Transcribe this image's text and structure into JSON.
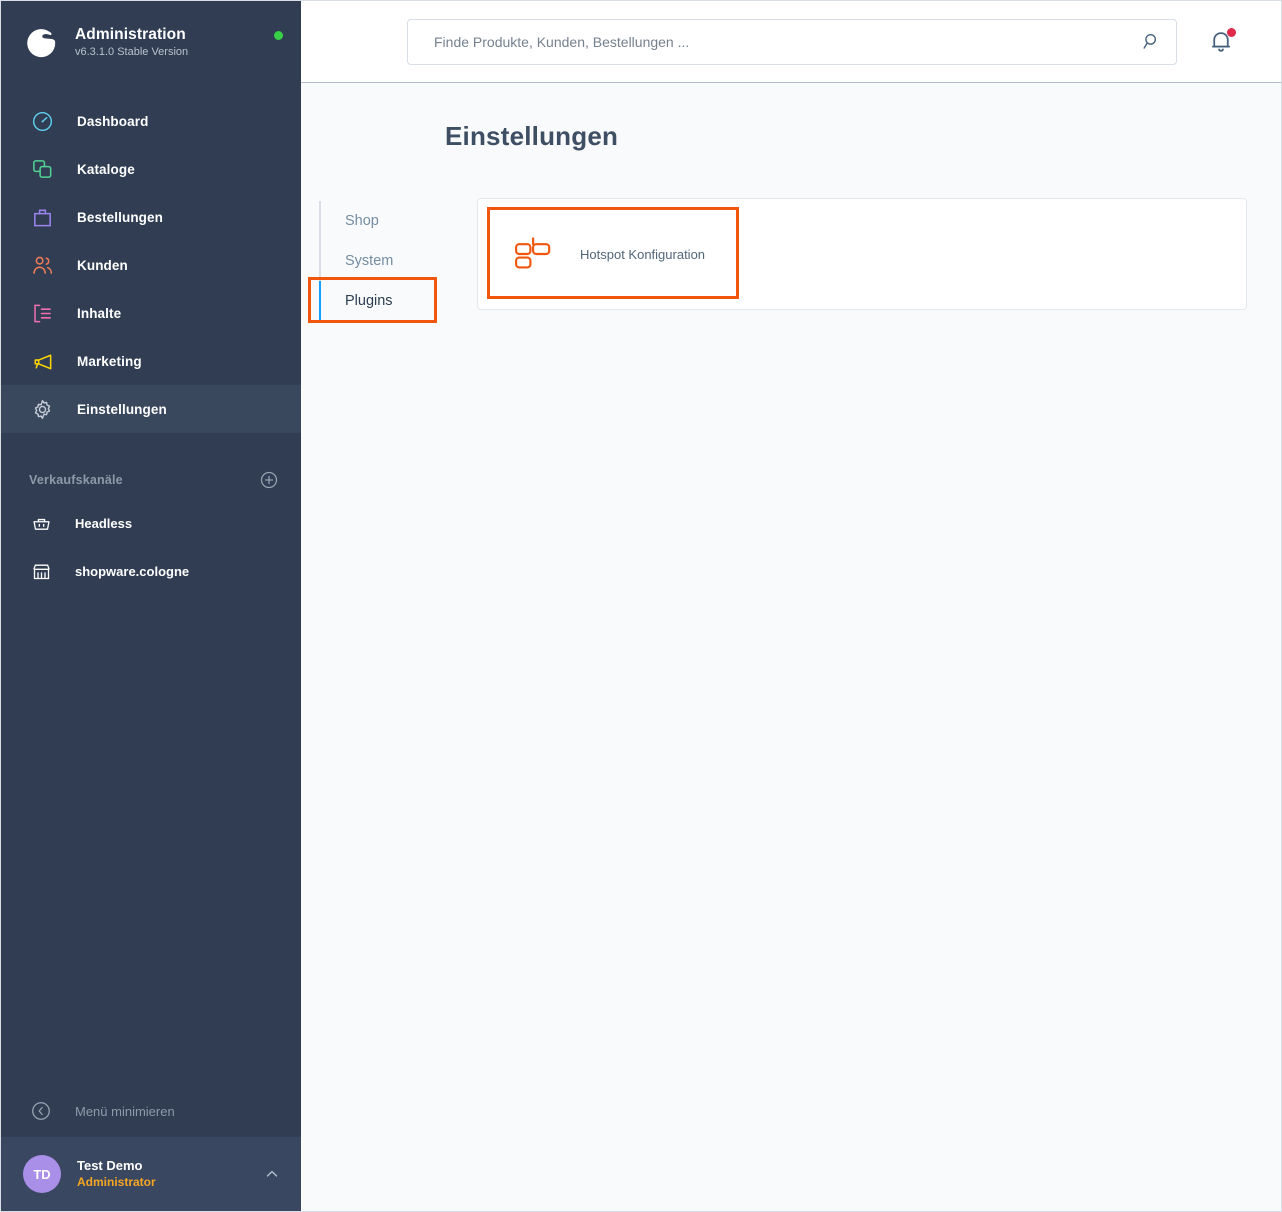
{
  "app": {
    "brand_title": "Administration",
    "brand_version": "v6.3.1.0 Stable Version",
    "status_indicator": "online-dot",
    "logo_icon": "shopware-logo-icon"
  },
  "sidebar": {
    "items": [
      {
        "label": "Dashboard",
        "icon": "speedometer-icon",
        "color": "#5ecfee",
        "active": false
      },
      {
        "label": "Kataloge",
        "icon": "stacked-squares-icon",
        "color": "#52d292",
        "active": false
      },
      {
        "label": "Bestellungen",
        "icon": "shopping-bag-icon",
        "color": "#9b84ee",
        "active": false
      },
      {
        "label": "Kunden",
        "icon": "people-icon",
        "color": "#ef7c59",
        "active": false
      },
      {
        "label": "Inhalte",
        "icon": "content-list-icon",
        "color": "#ee6fb2",
        "active": false
      },
      {
        "label": "Marketing",
        "icon": "megaphone-icon",
        "color": "#ffd600",
        "active": false
      },
      {
        "label": "Einstellungen",
        "icon": "gear-icon",
        "color": "#c4cbd6",
        "active": true
      }
    ],
    "sales_channels": {
      "title": "Verkaufskanäle",
      "add_icon": "plus-circle-icon",
      "items": [
        {
          "label": "Headless",
          "icon": "basket-icon"
        },
        {
          "label": "shopware.cologne",
          "icon": "storefront-icon"
        }
      ]
    },
    "minimize": {
      "label": "Menü minimieren",
      "icon": "chevron-left-circle-icon"
    },
    "user": {
      "initials": "TD",
      "name": "Test Demo",
      "role": "Administrator",
      "chevron_icon": "chevron-up-icon"
    }
  },
  "topbar": {
    "search": {
      "placeholder": "Finde Produkte, Kunden, Bestellungen ...",
      "value": "",
      "icon": "search-icon"
    },
    "notifications": {
      "icon": "bell-icon",
      "badge_color": "#de294c",
      "has_unread": true
    }
  },
  "main": {
    "page_title": "Einstellungen",
    "tabs": [
      {
        "label": "Shop",
        "active": false
      },
      {
        "label": "System",
        "active": false
      },
      {
        "label": "Plugins",
        "active": true
      }
    ],
    "plugins": [
      {
        "label": "Hotspot Konfiguration",
        "icon": "gb-plugin-logo-icon"
      }
    ]
  },
  "annotations": {
    "highlight_color": "#f0560d",
    "targets": [
      "plugins-tab",
      "hotspot-konfiguration-tile"
    ]
  }
}
